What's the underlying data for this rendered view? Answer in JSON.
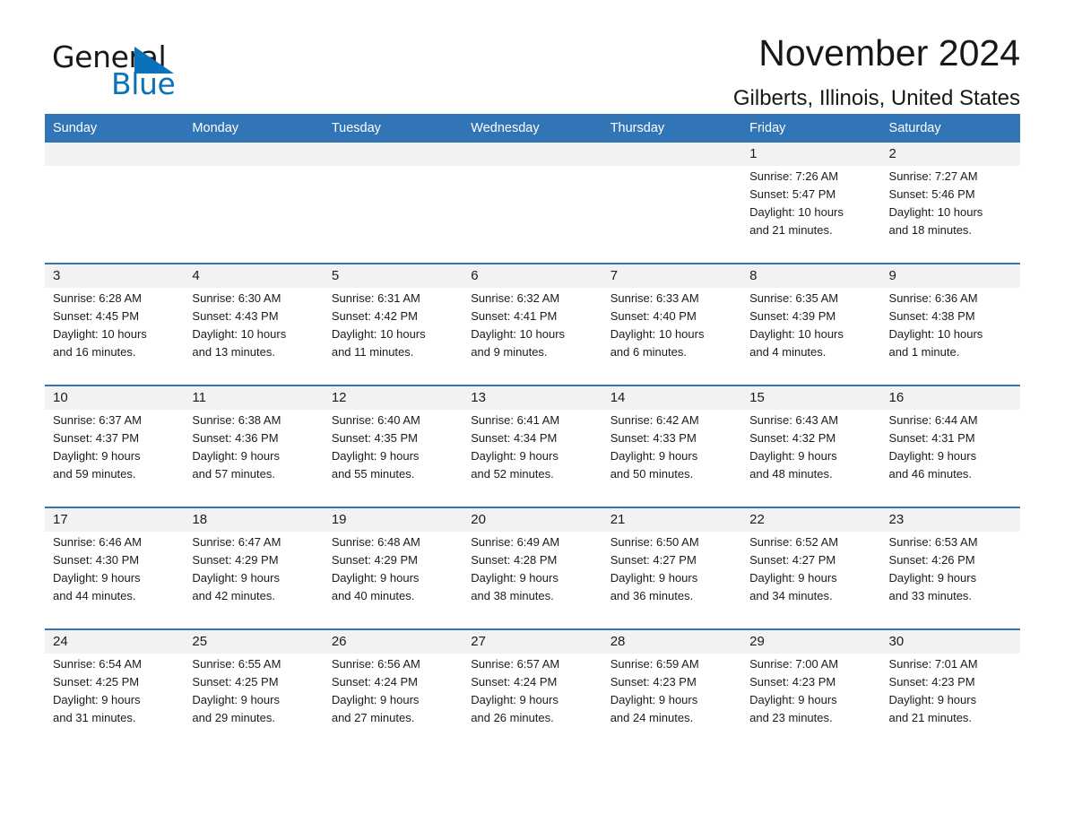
{
  "brand": {
    "name_part1": "General",
    "name_part2": "Blue",
    "logo_icon": "triangle-flag-icon",
    "accent_color": "#0b72ba"
  },
  "header": {
    "month_title": "November 2024",
    "location": "Gilberts, Illinois, United States"
  },
  "calendar": {
    "header_background": "#3275b6",
    "daynum_background": "#f2f2f2",
    "row_separator_color": "#2f74b5",
    "weekday_headers": [
      "Sunday",
      "Monday",
      "Tuesday",
      "Wednesday",
      "Thursday",
      "Friday",
      "Saturday"
    ],
    "weeks": [
      [
        {
          "day": "",
          "lines": [
            "",
            "",
            "",
            ""
          ]
        },
        {
          "day": "",
          "lines": [
            "",
            "",
            "",
            ""
          ]
        },
        {
          "day": "",
          "lines": [
            "",
            "",
            "",
            ""
          ]
        },
        {
          "day": "",
          "lines": [
            "",
            "",
            "",
            ""
          ]
        },
        {
          "day": "",
          "lines": [
            "",
            "",
            "",
            ""
          ]
        },
        {
          "day": "1",
          "lines": [
            "Sunrise: 7:26 AM",
            "Sunset: 5:47 PM",
            "Daylight: 10 hours",
            "and 21 minutes."
          ]
        },
        {
          "day": "2",
          "lines": [
            "Sunrise: 7:27 AM",
            "Sunset: 5:46 PM",
            "Daylight: 10 hours",
            "and 18 minutes."
          ]
        }
      ],
      [
        {
          "day": "3",
          "lines": [
            "Sunrise: 6:28 AM",
            "Sunset: 4:45 PM",
            "Daylight: 10 hours",
            "and 16 minutes."
          ]
        },
        {
          "day": "4",
          "lines": [
            "Sunrise: 6:30 AM",
            "Sunset: 4:43 PM",
            "Daylight: 10 hours",
            "and 13 minutes."
          ]
        },
        {
          "day": "5",
          "lines": [
            "Sunrise: 6:31 AM",
            "Sunset: 4:42 PM",
            "Daylight: 10 hours",
            "and 11 minutes."
          ]
        },
        {
          "day": "6",
          "lines": [
            "Sunrise: 6:32 AM",
            "Sunset: 4:41 PM",
            "Daylight: 10 hours",
            "and 9 minutes."
          ]
        },
        {
          "day": "7",
          "lines": [
            "Sunrise: 6:33 AM",
            "Sunset: 4:40 PM",
            "Daylight: 10 hours",
            "and 6 minutes."
          ]
        },
        {
          "day": "8",
          "lines": [
            "Sunrise: 6:35 AM",
            "Sunset: 4:39 PM",
            "Daylight: 10 hours",
            "and 4 minutes."
          ]
        },
        {
          "day": "9",
          "lines": [
            "Sunrise: 6:36 AM",
            "Sunset: 4:38 PM",
            "Daylight: 10 hours",
            "and 1 minute."
          ]
        }
      ],
      [
        {
          "day": "10",
          "lines": [
            "Sunrise: 6:37 AM",
            "Sunset: 4:37 PM",
            "Daylight: 9 hours",
            "and 59 minutes."
          ]
        },
        {
          "day": "11",
          "lines": [
            "Sunrise: 6:38 AM",
            "Sunset: 4:36 PM",
            "Daylight: 9 hours",
            "and 57 minutes."
          ]
        },
        {
          "day": "12",
          "lines": [
            "Sunrise: 6:40 AM",
            "Sunset: 4:35 PM",
            "Daylight: 9 hours",
            "and 55 minutes."
          ]
        },
        {
          "day": "13",
          "lines": [
            "Sunrise: 6:41 AM",
            "Sunset: 4:34 PM",
            "Daylight: 9 hours",
            "and 52 minutes."
          ]
        },
        {
          "day": "14",
          "lines": [
            "Sunrise: 6:42 AM",
            "Sunset: 4:33 PM",
            "Daylight: 9 hours",
            "and 50 minutes."
          ]
        },
        {
          "day": "15",
          "lines": [
            "Sunrise: 6:43 AM",
            "Sunset: 4:32 PM",
            "Daylight: 9 hours",
            "and 48 minutes."
          ]
        },
        {
          "day": "16",
          "lines": [
            "Sunrise: 6:44 AM",
            "Sunset: 4:31 PM",
            "Daylight: 9 hours",
            "and 46 minutes."
          ]
        }
      ],
      [
        {
          "day": "17",
          "lines": [
            "Sunrise: 6:46 AM",
            "Sunset: 4:30 PM",
            "Daylight: 9 hours",
            "and 44 minutes."
          ]
        },
        {
          "day": "18",
          "lines": [
            "Sunrise: 6:47 AM",
            "Sunset: 4:29 PM",
            "Daylight: 9 hours",
            "and 42 minutes."
          ]
        },
        {
          "day": "19",
          "lines": [
            "Sunrise: 6:48 AM",
            "Sunset: 4:29 PM",
            "Daylight: 9 hours",
            "and 40 minutes."
          ]
        },
        {
          "day": "20",
          "lines": [
            "Sunrise: 6:49 AM",
            "Sunset: 4:28 PM",
            "Daylight: 9 hours",
            "and 38 minutes."
          ]
        },
        {
          "day": "21",
          "lines": [
            "Sunrise: 6:50 AM",
            "Sunset: 4:27 PM",
            "Daylight: 9 hours",
            "and 36 minutes."
          ]
        },
        {
          "day": "22",
          "lines": [
            "Sunrise: 6:52 AM",
            "Sunset: 4:27 PM",
            "Daylight: 9 hours",
            "and 34 minutes."
          ]
        },
        {
          "day": "23",
          "lines": [
            "Sunrise: 6:53 AM",
            "Sunset: 4:26 PM",
            "Daylight: 9 hours",
            "and 33 minutes."
          ]
        }
      ],
      [
        {
          "day": "24",
          "lines": [
            "Sunrise: 6:54 AM",
            "Sunset: 4:25 PM",
            "Daylight: 9 hours",
            "and 31 minutes."
          ]
        },
        {
          "day": "25",
          "lines": [
            "Sunrise: 6:55 AM",
            "Sunset: 4:25 PM",
            "Daylight: 9 hours",
            "and 29 minutes."
          ]
        },
        {
          "day": "26",
          "lines": [
            "Sunrise: 6:56 AM",
            "Sunset: 4:24 PM",
            "Daylight: 9 hours",
            "and 27 minutes."
          ]
        },
        {
          "day": "27",
          "lines": [
            "Sunrise: 6:57 AM",
            "Sunset: 4:24 PM",
            "Daylight: 9 hours",
            "and 26 minutes."
          ]
        },
        {
          "day": "28",
          "lines": [
            "Sunrise: 6:59 AM",
            "Sunset: 4:23 PM",
            "Daylight: 9 hours",
            "and 24 minutes."
          ]
        },
        {
          "day": "29",
          "lines": [
            "Sunrise: 7:00 AM",
            "Sunset: 4:23 PM",
            "Daylight: 9 hours",
            "and 23 minutes."
          ]
        },
        {
          "day": "30",
          "lines": [
            "Sunrise: 7:01 AM",
            "Sunset: 4:23 PM",
            "Daylight: 9 hours",
            "and 21 minutes."
          ]
        }
      ]
    ]
  }
}
